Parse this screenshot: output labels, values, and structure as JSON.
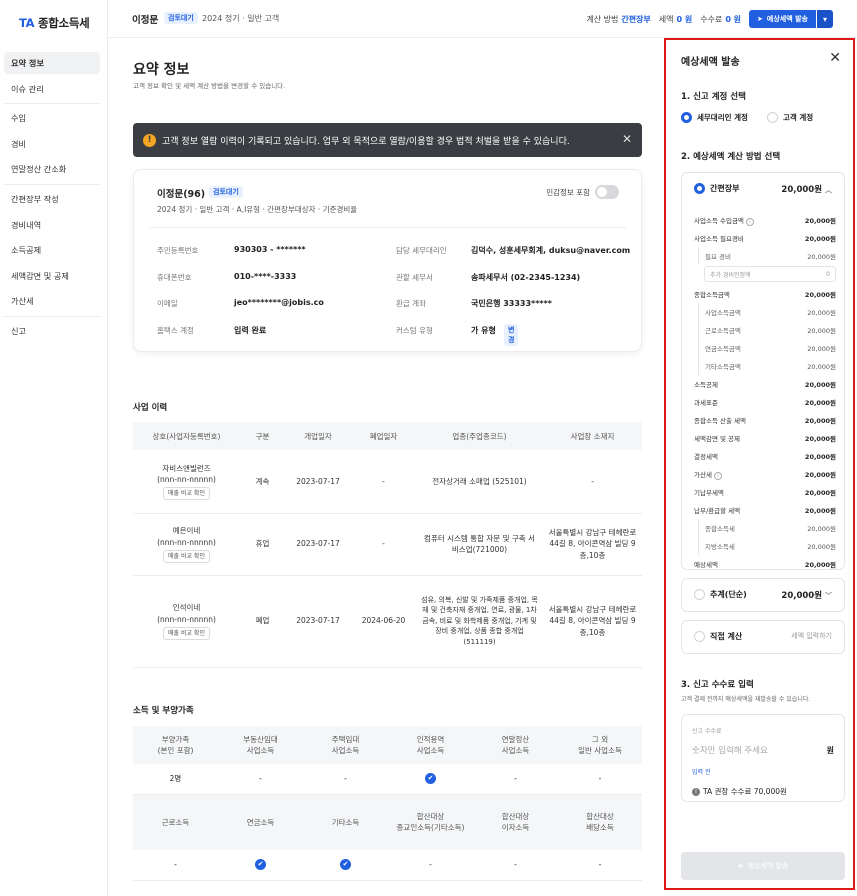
{
  "app": {
    "logo_ta": "TA",
    "logo_text": "종합소득세"
  },
  "sidebar": {
    "items": [
      {
        "label": "요약 정보",
        "active": true
      },
      {
        "label": "이슈 관리"
      },
      {
        "label": "수입"
      },
      {
        "label": "경비"
      },
      {
        "label": "연말정산 간소화"
      },
      {
        "label": "간편장부 작성"
      },
      {
        "label": "경비내역"
      },
      {
        "label": "소득공제"
      },
      {
        "label": "세액감면 및 공제"
      },
      {
        "label": "가산세"
      },
      {
        "label": "신고"
      }
    ]
  },
  "topbar": {
    "client": "이정문",
    "badge": "검토대기",
    "sub": "2024 정기 · 일반 고객",
    "method_label": "계산 방법",
    "method_value": "간편장부",
    "tax_label": "세액",
    "tax_value": "0 원",
    "fee_label": "수수료",
    "fee_value": "0 원",
    "send_label": "예상세액 발송"
  },
  "main": {
    "title": "요약 정보",
    "desc": "고객 정보 확인 및 세액 계산 방법을 변경할 수 있습니다.",
    "alert": "고객 정보 열람 이력이 기록되고 있습니다. 업무 외 목적으로 열람/이용할 경우 법적 처벌을 받을 수 있습니다.",
    "card": {
      "name": "이정문(96)",
      "badge": "검토대기",
      "sub": "2024 정기 · 일반 고객 · A,I유형 · 간편장부대상자 · 기준경비율",
      "toggle_label": "민감정보 포함",
      "fields": {
        "rrn_k": "주민등록번호",
        "rrn_v": "930303  -  *******",
        "phone_k": "휴대폰번호",
        "phone_v": "010-****-3333",
        "email_k": "이메일",
        "email_v": "jeo********@jobis.co",
        "hometax_k": "홈택스 계정",
        "hometax_v": "입력 완료",
        "agent_k": "담당 세무대리인",
        "agent_v": "김덕수, 성훈세무회계, duksu@naver.com",
        "office_k": "관할 세무서",
        "office_v": "송파세무서 (02-2345-1234)",
        "refund_k": "환급 계좌",
        "refund_v": "국민은행  33333*****",
        "custom_k": "커스텀 유형",
        "custom_v": "가 유형",
        "custom_btn": "변경"
      }
    },
    "biz": {
      "title": "사업 이력",
      "headers": [
        "상호(사업자등록번호)",
        "구분",
        "개업일자",
        "폐업일자",
        "업종(주업종코드)",
        "사업장 소재지"
      ],
      "btn": "매출 비교 확인",
      "rows": [
        {
          "name": "자비스앤빌런즈",
          "reg": "(nnn-nn-nnnnn)",
          "type": "계속",
          "open": "2023-07-17",
          "close": "-",
          "industry": "전자상거래 소매업 (525101)",
          "addr": "-"
        },
        {
          "name": "예은이네",
          "reg": "(nnn-nn-nnnnn)",
          "type": "휴업",
          "open": "2023-07-17",
          "close": "-",
          "industry": "컴퓨터 시스템 통합 자문 및 구축 서비스업(721000)",
          "addr": "서울특별시 강남구 테헤란로 44길 8, 아이콘역삼 빌딩 9층,10층"
        },
        {
          "name": "인석이네",
          "reg": "(nnn-nn-nnnnn)",
          "type": "폐업",
          "open": "2023-07-17",
          "close": "2024-06-20",
          "industry": "섬유, 의복, 신발 및 가죽제품 중개업, 목재 및 건축자재 중개업, 연료, 광물, 1차 금속, 비료 및 화학제품 중개업, 기계 및 장비 중개업, 상품 종합 중개업(511119)",
          "addr": "서울특별시 강남구 테헤란로 44길 8, 아이콘역삼 빌딩 9층,10층"
        }
      ]
    },
    "income": {
      "title": "소득 및 부양가족",
      "headers1": [
        "부양가족\n(본인 포함)",
        "부동산임대\n사업소득",
        "주택임대\n사업소득",
        "인적용역\n사업소득",
        "연말정산\n사업소득",
        "그 외\n일반 사업소득"
      ],
      "row1": [
        "2명",
        "-",
        "-",
        "✔",
        "-",
        "-"
      ],
      "headers2": [
        "근로소득",
        "연금소득",
        "기타소득",
        "합산대상\n종교인소득(기타소득)",
        "합산대상\n이자소득",
        "합산대상\n배당소득"
      ],
      "row2": [
        "-",
        "✔",
        "✔",
        "-",
        "-",
        "-"
      ]
    }
  },
  "panel": {
    "title": "예상세액 발송",
    "sec1": "1. 신고 계정 선택",
    "acct_agent": "세무대리인 계정",
    "acct_client": "고객 계정",
    "sec2": "2. 예상세액 계산 방법 선택",
    "simple": {
      "label": "간편장부",
      "amount": "20,000원",
      "rows": [
        {
          "k": "사업소득 수입금액",
          "v": "20,000원",
          "info": true
        },
        {
          "k": "사업소득 필요경비",
          "v": "20,000원"
        },
        {
          "k": "필요 경비",
          "v": "20,000원",
          "sub": true
        },
        {
          "k": "추가 경비인정액",
          "v": "0",
          "input": true
        },
        {
          "k": "종합소득금액",
          "v": "20,000원"
        },
        {
          "k": "사업소득금액",
          "v": "20,000원",
          "sub": true
        },
        {
          "k": "근로소득금액",
          "v": "20,000원",
          "sub": true
        },
        {
          "k": "연금소득금액",
          "v": "20,000원",
          "sub": true
        },
        {
          "k": "기타소득금액",
          "v": "20,000원",
          "sub": true
        },
        {
          "k": "소득공제",
          "v": "20,000원"
        },
        {
          "k": "과세표준",
          "v": "20,000원"
        },
        {
          "k": "종합소득 산출 세액",
          "v": "20,000원"
        },
        {
          "k": "세액감면 및 공제",
          "v": "20,000원"
        },
        {
          "k": "결정세액",
          "v": "20,000원"
        },
        {
          "k": "가산세",
          "v": "20,000원",
          "info": true
        },
        {
          "k": "기납부세액",
          "v": "20,000원"
        },
        {
          "k": "납부/환급할 세액",
          "v": "20,000원"
        },
        {
          "k": "종합소득세",
          "v": "20,000원",
          "sub": true
        },
        {
          "k": "지방소득세",
          "v": "20,000원",
          "sub": true
        },
        {
          "k": "예상세액",
          "v": "20,000원"
        }
      ]
    },
    "estimate": {
      "label": "추계(단순)",
      "amount": "20,000원"
    },
    "direct": {
      "label": "직접 계산",
      "action": "세액 입력하기"
    },
    "sec3": "3. 신고 수수료 입력",
    "sec3_desc": "고객 결제 전까지 예상세액을 재발송할 수 있습니다.",
    "fee": {
      "label": "신고 수수료",
      "placeholder": "숫자만 입력해 주세요",
      "unit": "원",
      "hint": "입력 전",
      "recommend": "TA 권장 수수료 70,000원"
    },
    "send": "예상세액 발송"
  }
}
